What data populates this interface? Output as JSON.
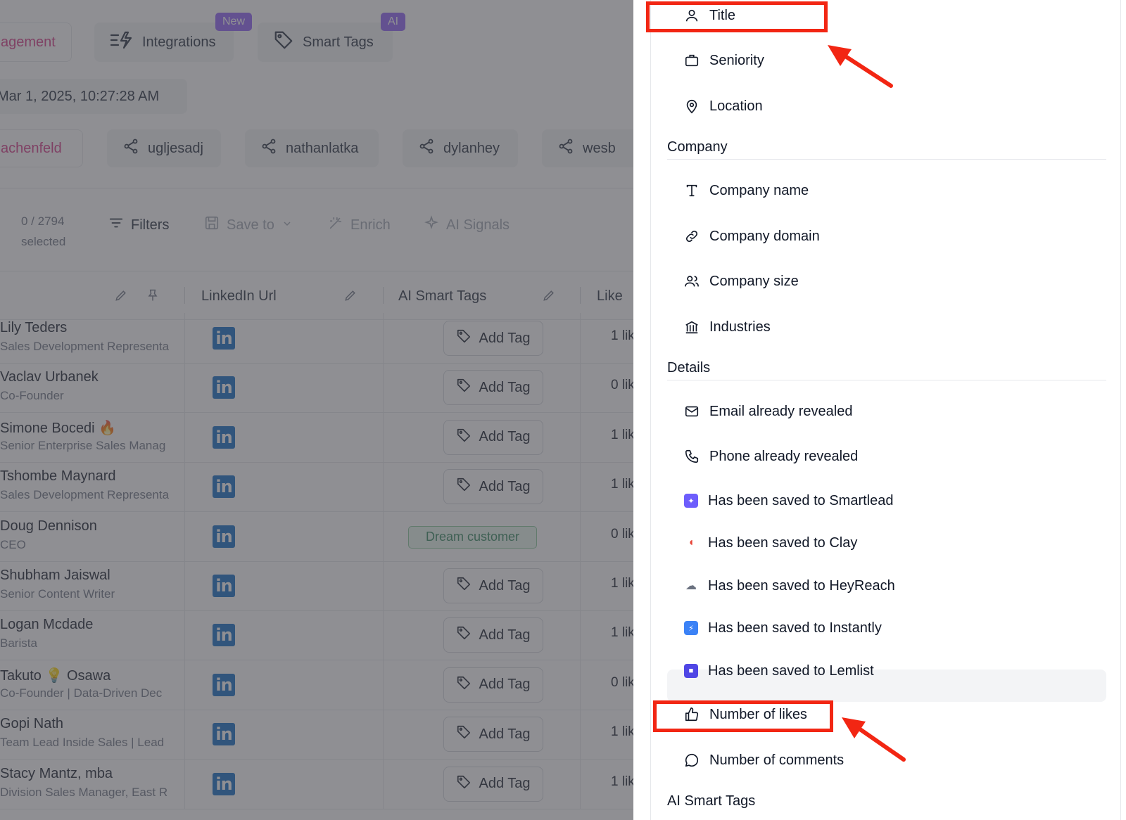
{
  "top_tabs": {
    "management": "agement",
    "integrations": "Integrations",
    "integrations_badge": "New",
    "smart_tags": "Smart Tags",
    "smart_tags_badge": "AI"
  },
  "timestamp": "Mar 1, 2025, 10:27:28 AM",
  "sources": [
    {
      "label": "achenfeld"
    },
    {
      "label": "ugljesadj"
    },
    {
      "label": "nathanlatka"
    },
    {
      "label": "dylanhey"
    },
    {
      "label": "wesb"
    }
  ],
  "toolbar": {
    "selected_count": "0 / 2794",
    "selected_label": "selected",
    "filters": "Filters",
    "save_to": "Save to",
    "enrich": "Enrich",
    "ai_signals": "AI Signals"
  },
  "table": {
    "headers": {
      "linkedin_url": "LinkedIn Url",
      "ai_smart_tags": "AI Smart Tags",
      "likes": "Like"
    },
    "add_tag_label": "Add Tag",
    "rows": [
      {
        "name": "Lily Teders",
        "sub": "Sales Development Representa",
        "likes": "1 lik"
      },
      {
        "name": "Vaclav Urbanek",
        "sub": "Co-Founder",
        "likes": "0 lik"
      },
      {
        "name": "Simone Bocedi 🔥",
        "sub": "Senior Enterprise Sales Manag",
        "likes": "1 lik"
      },
      {
        "name": "Tshombe Maynard",
        "sub": "Sales Development Representa",
        "likes": "1 lik"
      },
      {
        "name": "Doug Dennison",
        "sub": "CEO",
        "likes": "0 lik",
        "tag": "Dream customer"
      },
      {
        "name": "Shubham Jaiswal",
        "sub": "Senior Content Writer",
        "likes": "1 lik"
      },
      {
        "name": "Logan Mcdade",
        "sub": "Barista",
        "likes": "1 lik"
      },
      {
        "name": "Takuto 💡 Osawa",
        "sub": "Co-Founder | Data-Driven Dec",
        "likes": "0 lik"
      },
      {
        "name": "Gopi Nath",
        "sub": "Team Lead Inside Sales | Lead",
        "likes": "1 lik"
      },
      {
        "name": "Stacy Mantz, mba",
        "sub": "Division Sales Manager, East R",
        "likes": "1 lik"
      }
    ]
  },
  "panel": {
    "person_items": [
      "Title",
      "Seniority",
      "Location"
    ],
    "company_section": "Company",
    "company_items": [
      "Company name",
      "Company domain",
      "Company size",
      "Industries"
    ],
    "details_section": "Details",
    "details_items": [
      "Email already revealed",
      "Phone already revealed",
      "Has been saved to Smartlead",
      "Has been saved to Clay",
      "Has been saved to HeyReach",
      "Has been saved to Instantly",
      "Has been saved to Lemlist",
      "Number of likes",
      "Number of comments"
    ],
    "ai_section": "AI Smart Tags"
  },
  "colors": {
    "highlight": "#f22613",
    "linkedin": "#0a66c2",
    "brand_pink": "#d63384",
    "badge": "#8b5cf6"
  }
}
